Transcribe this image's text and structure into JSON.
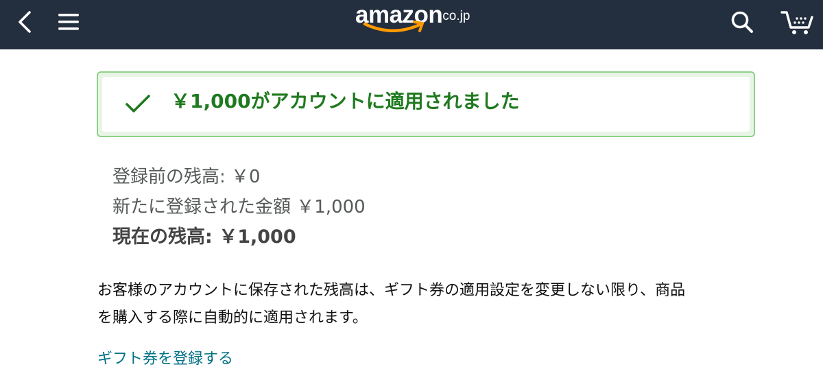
{
  "header": {
    "logo_word": "amazon",
    "logo_tld": ".co.jp",
    "icons": {
      "back": "chevron-left-icon",
      "menu": "hamburger-menu-icon",
      "search": "search-icon",
      "cart": "cart-icon"
    },
    "colors": {
      "bar": "#232f3e",
      "smile": "#ff9900"
    }
  },
  "alert": {
    "icon": "check-icon",
    "message": "￥1,000がアカウントに適用されました",
    "colors": {
      "text": "#1f7a1f",
      "border": "#8fd088"
    }
  },
  "balances": {
    "before": "登録前の残高: ￥0",
    "added": "新たに登録された金額 ￥1,000",
    "current": "現在の残高: ￥1,000"
  },
  "note": {
    "line1": "お客様のアカウントに保存された残高は、ギフト券の適用設定を変更しない限り、商品",
    "line2": "を購入する際に自動的に適用されます。"
  },
  "link": {
    "label": "ギフト券を登録する"
  }
}
